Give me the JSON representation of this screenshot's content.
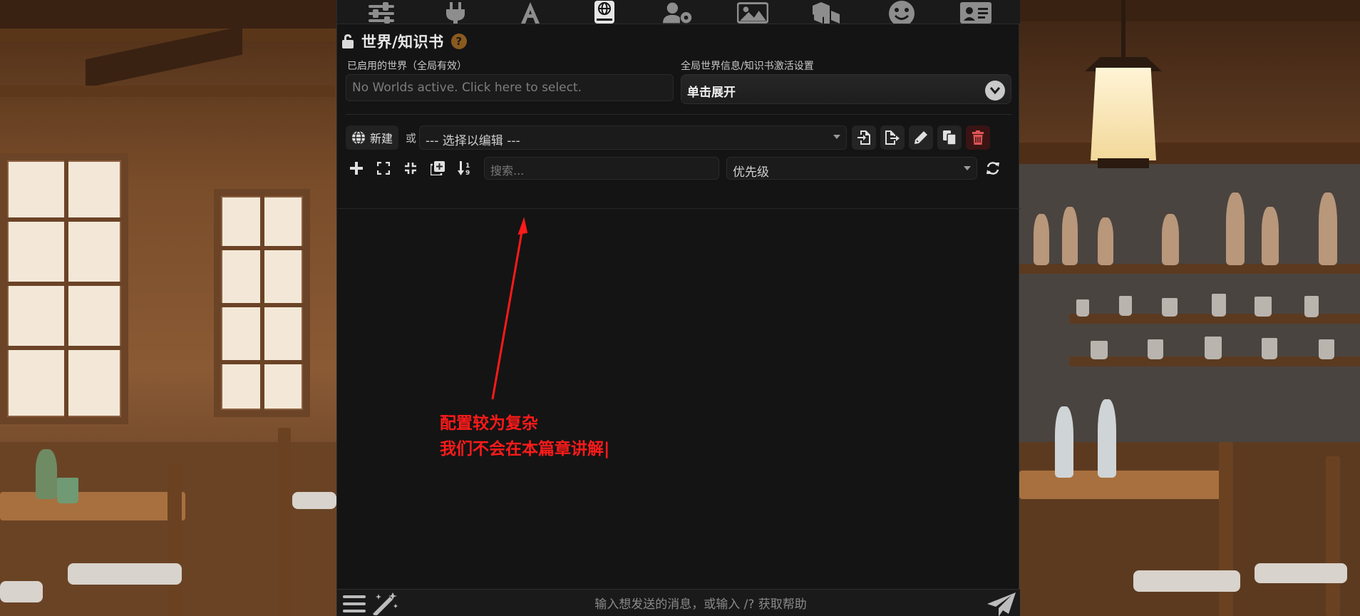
{
  "app": {
    "colors": {
      "panel_bg": "#141414",
      "annotation": "#ff1a1a",
      "help_badge": "#8b5a1e",
      "delete_bg": "#3a1414"
    }
  },
  "topnav": {
    "icons": [
      "sliders-icon",
      "plug-icon",
      "font-icon",
      "book-globe-icon",
      "user-gear-icon",
      "image-icon",
      "cubes-icon",
      "smile-icon",
      "id-card-icon"
    ],
    "active": "book-globe-icon"
  },
  "worldinfo": {
    "title": "世界/知识书",
    "help": "?",
    "active_worlds_label": "已启用的世界（全局有效）",
    "active_worlds_placeholder": "No Worlds active. Click here to select.",
    "activation_label": "全局世界信息/知识书激活设置",
    "activation_value": "单击展开"
  },
  "editor": {
    "new_label": "新建",
    "or_label": "或",
    "select_placeholder": "--- 选择以编辑 ---",
    "search_placeholder": "搜索...",
    "sort_value": "优先级"
  },
  "annotation": {
    "line1": "配置较为复杂",
    "line2": "我们不会在本篇章讲解|"
  },
  "chat": {
    "input_placeholder": "输入想发送的消息，或输入 /? 获取帮助"
  }
}
